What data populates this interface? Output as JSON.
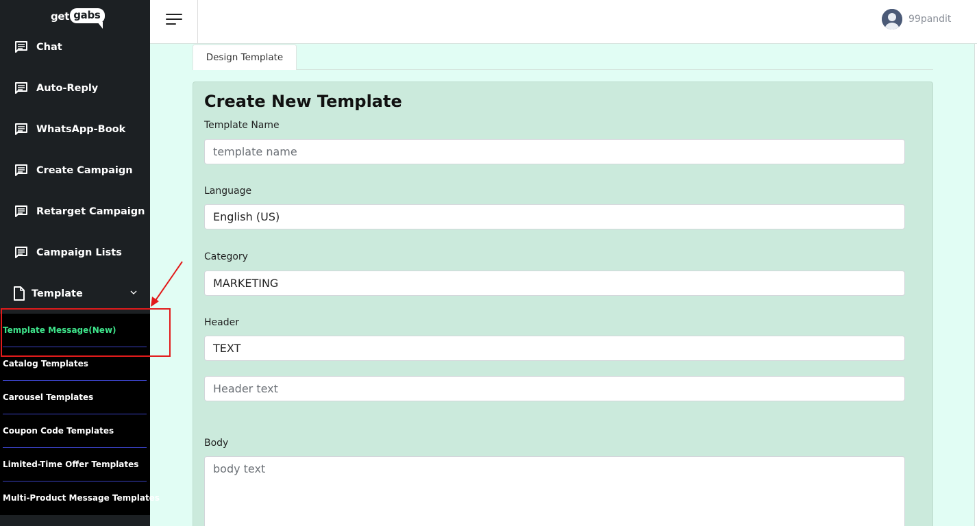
{
  "brand": {
    "part1": "get",
    "part2": "gabs"
  },
  "sidebar": {
    "items": [
      {
        "label": "Chat",
        "icon": "message-icon"
      },
      {
        "label": "Auto-Reply",
        "icon": "message-icon"
      },
      {
        "label": "WhatsApp-Book",
        "icon": "message-icon"
      },
      {
        "label": "Create Campaign",
        "icon": "message-icon"
      },
      {
        "label": "Retarget Campaign",
        "icon": "message-icon"
      },
      {
        "label": "Campaign Lists",
        "icon": "message-icon"
      }
    ],
    "template": {
      "label": "Template",
      "icon": "file-icon",
      "expanded": true
    },
    "submenu": [
      {
        "label": "Template Message(New)",
        "active": true
      },
      {
        "label": "Catalog Templates"
      },
      {
        "label": "Carousel Templates"
      },
      {
        "label": "Coupon Code Templates"
      },
      {
        "label": "Limited-Time Offer Templates"
      },
      {
        "label": "Multi-Product Message Templates"
      }
    ],
    "colors": {
      "background": "#1c2023",
      "submenu_bg": "#000000",
      "active_text": "#3ee38a",
      "separator": "#3b43c8",
      "annotation": "#e21b1b"
    }
  },
  "topbar": {
    "username": "99pandit"
  },
  "tabs": {
    "active": "Design Template"
  },
  "form": {
    "title": "Create New Template",
    "template_name": {
      "label": "Template Name",
      "placeholder": "template name"
    },
    "language": {
      "label": "Language",
      "value": "English (US)"
    },
    "category": {
      "label": "Category",
      "value": "MARKETING"
    },
    "header": {
      "label": "Header",
      "value": "TEXT",
      "text_placeholder": "Header text"
    },
    "body": {
      "label": "Body",
      "placeholder": "body text"
    }
  }
}
